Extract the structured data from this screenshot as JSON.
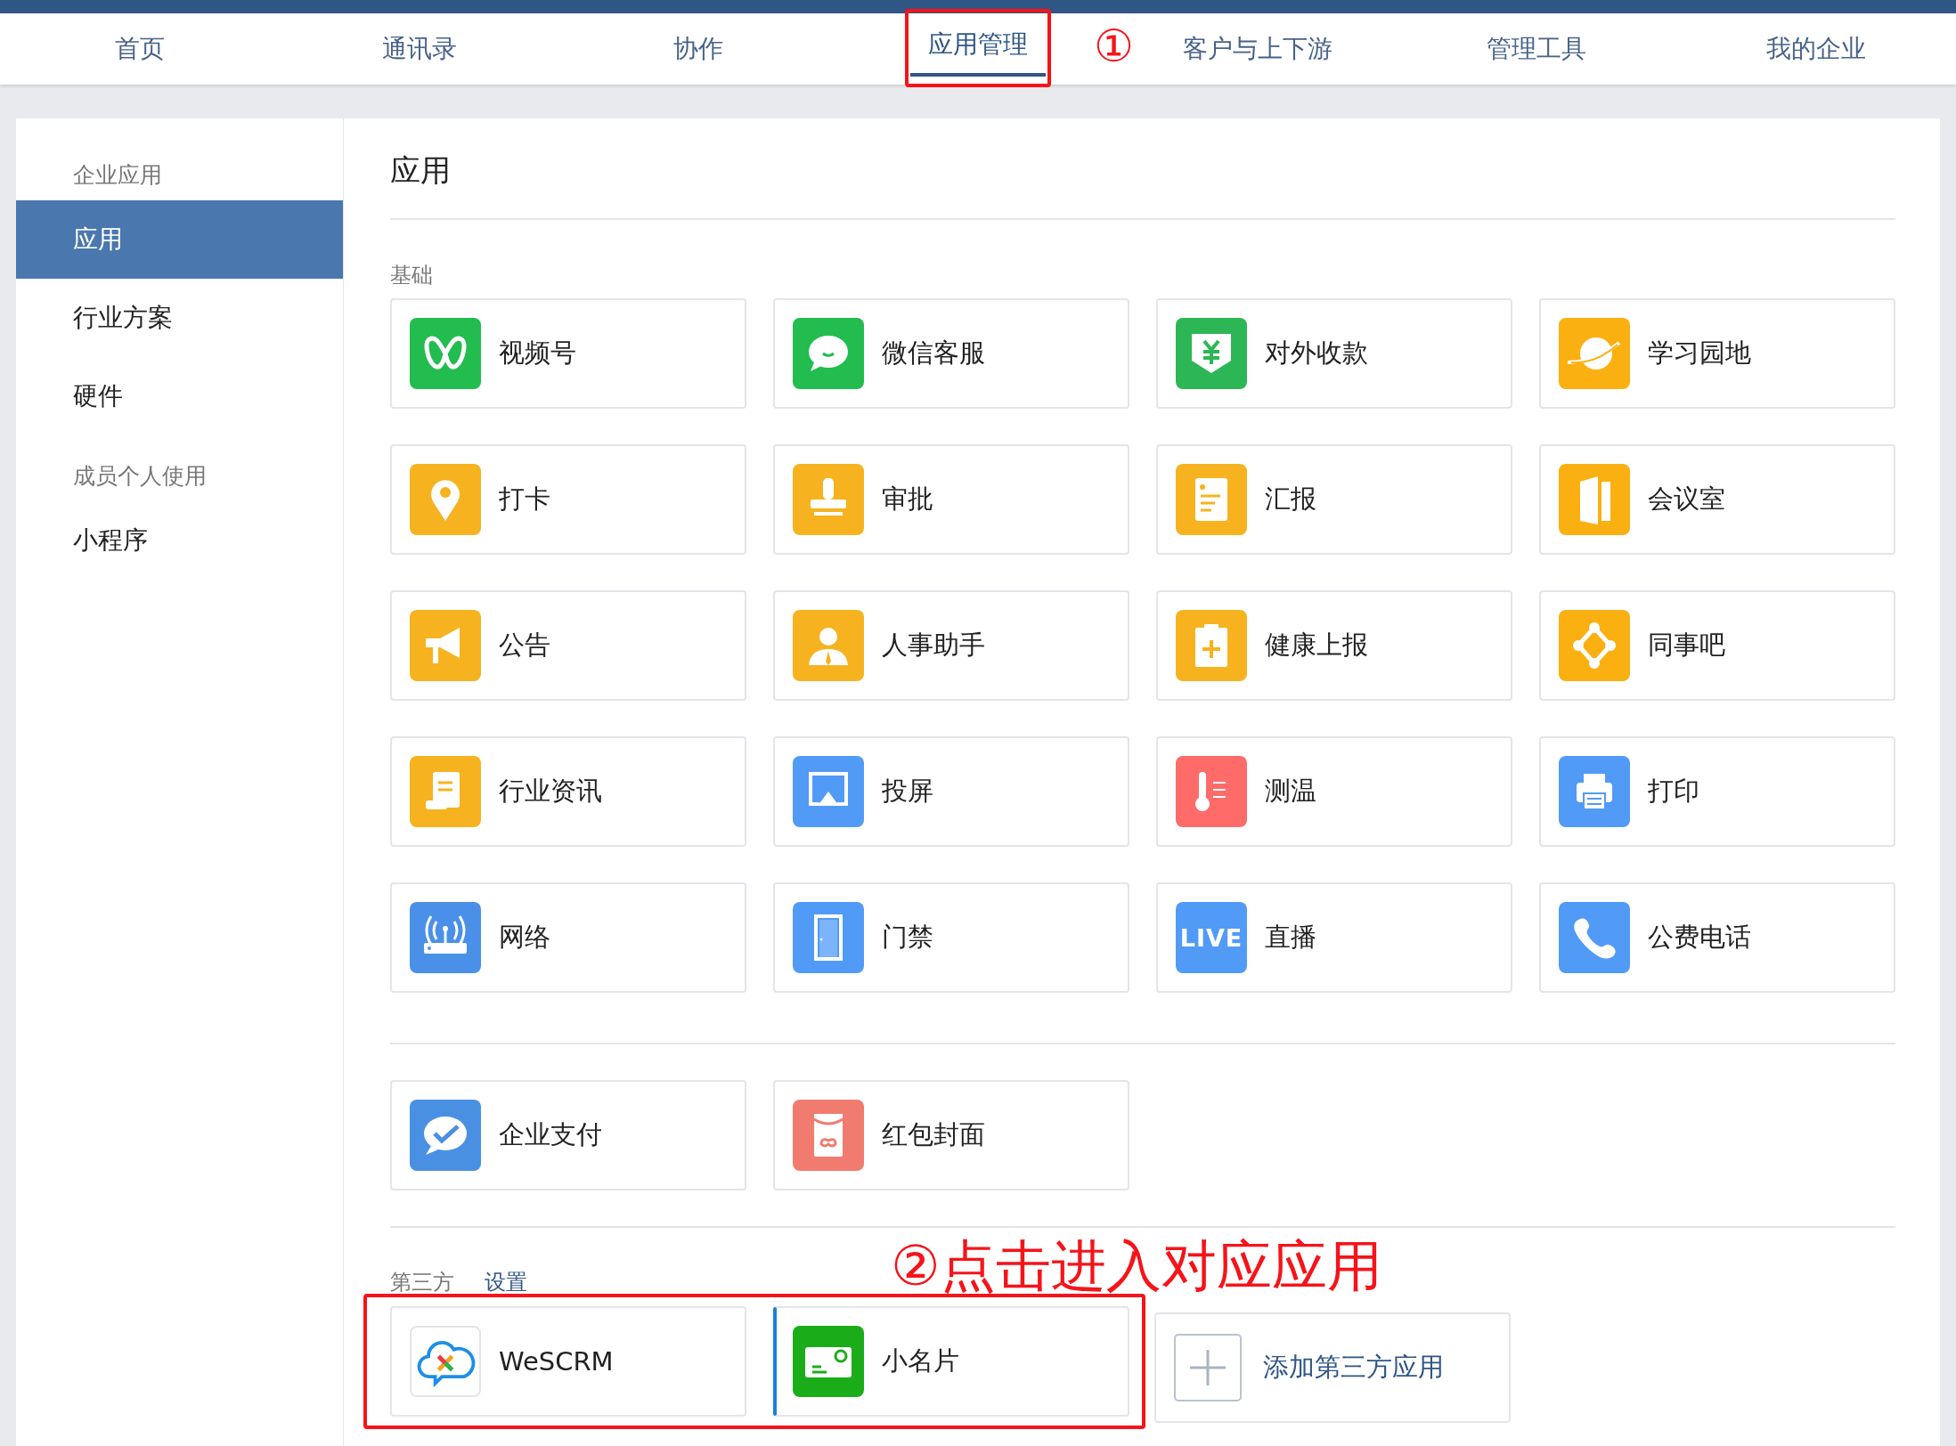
{
  "nav": {
    "tabs": [
      {
        "label": "首页",
        "selected": false,
        "highlighted": false
      },
      {
        "label": "通讯录",
        "selected": false,
        "highlighted": false
      },
      {
        "label": "协作",
        "selected": false,
        "highlighted": false
      },
      {
        "label": "应用管理",
        "selected": true,
        "highlighted": true,
        "annotation": "①"
      },
      {
        "label": "客户与上下游",
        "selected": false,
        "highlighted": false
      },
      {
        "label": "管理工具",
        "selected": false,
        "highlighted": false
      },
      {
        "label": "我的企业",
        "selected": false,
        "highlighted": false
      }
    ]
  },
  "sidebar": {
    "groups": [
      {
        "title": "企业应用",
        "items": [
          {
            "label": "应用",
            "selected": true
          },
          {
            "label": "行业方案",
            "selected": false
          },
          {
            "label": "硬件",
            "selected": false
          }
        ]
      },
      {
        "title": "成员个人使用",
        "items": [
          {
            "label": "小程序",
            "selected": false
          }
        ]
      }
    ]
  },
  "content": {
    "title": "应用",
    "basic": {
      "label": "基础",
      "apps": [
        {
          "name": "视频号",
          "kind": "channels",
          "color": "#22bc4f"
        },
        {
          "name": "微信客服",
          "kind": "chat",
          "color": "#22bc4f"
        },
        {
          "name": "对外收款",
          "kind": "shield",
          "color": "#2db656"
        },
        {
          "name": "学习园地",
          "kind": "planet",
          "color": "#fbb012"
        },
        {
          "name": "打卡",
          "kind": "pin",
          "color": "#f6b31f"
        },
        {
          "name": "审批",
          "kind": "stamp",
          "color": "#f6b31f"
        },
        {
          "name": "汇报",
          "kind": "report",
          "color": "#f6b31f"
        },
        {
          "name": "会议室",
          "kind": "door",
          "color": "#fbb012"
        },
        {
          "name": "公告",
          "kind": "megaphone",
          "color": "#f6b31f"
        },
        {
          "name": "人事助手",
          "kind": "person",
          "color": "#f6b31f"
        },
        {
          "name": "健康上报",
          "kind": "clipboard",
          "color": "#f6b31f"
        },
        {
          "name": "同事吧",
          "kind": "nodes",
          "color": "#fbb012"
        },
        {
          "name": "行业资讯",
          "kind": "scroll",
          "color": "#f6b31f"
        },
        {
          "name": "投屏",
          "kind": "cast",
          "color": "#519bf7"
        },
        {
          "name": "测温",
          "kind": "thermo",
          "color": "#fe6b69"
        },
        {
          "name": "打印",
          "kind": "printer",
          "color": "#519bf7"
        },
        {
          "name": "网络",
          "kind": "router",
          "color": "#4a90e8"
        },
        {
          "name": "门禁",
          "kind": "gate",
          "color": "#519bf7"
        },
        {
          "name": "直播",
          "kind": "live",
          "color": "#519bf7",
          "icon_text": "LIVE"
        },
        {
          "name": "公费电话",
          "kind": "phone",
          "color": "#519bf7"
        }
      ]
    },
    "payment": {
      "apps": [
        {
          "name": "企业支付",
          "kind": "pay",
          "color": "#4a90e2"
        },
        {
          "name": "红包封面",
          "kind": "envelope",
          "color": "#f27b6f"
        }
      ]
    },
    "third_party": {
      "label": "第三方",
      "settings_link": "设置",
      "annotation": "②点击进入对应应用",
      "apps": [
        {
          "name": "WeSCRM",
          "kind": "cloud",
          "highlighted": true,
          "selected": false
        },
        {
          "name": "小名片",
          "kind": "card",
          "color": "#1aad19",
          "highlighted": true,
          "selected": true
        }
      ],
      "add_label": "添加第三方应用"
    }
  }
}
